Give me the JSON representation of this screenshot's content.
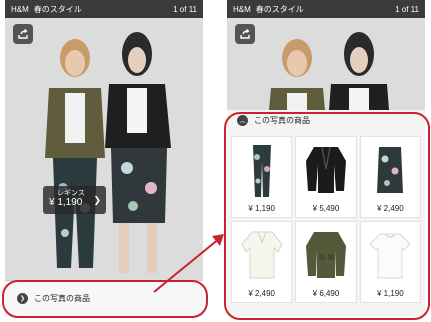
{
  "app": {
    "brand": "H&M",
    "title": "春のスタイル",
    "counter": "1 of 11"
  },
  "left_screen": {
    "icons": {
      "share": "share-icon"
    },
    "price_tag": {
      "category": "レギンス",
      "price": "¥ 1,190",
      "arrow": "chevron-right-icon"
    },
    "bottom_bar": {
      "label": "この写真の商品",
      "icon": "chevron-right-icon"
    }
  },
  "right_screen": {
    "panel": {
      "header": "この写真の商品",
      "icon": "chevron-up-icon",
      "items": [
        {
          "name": "leggings",
          "price": "¥ 1,190"
        },
        {
          "name": "leather-jacket",
          "price": "¥ 5,490"
        },
        {
          "name": "skirt",
          "price": "¥ 2,490"
        },
        {
          "name": "blouse",
          "price": "¥ 2,490"
        },
        {
          "name": "utility-jacket",
          "price": "¥ 6,490"
        },
        {
          "name": "tee",
          "price": "¥ 1,190"
        }
      ]
    }
  },
  "colors": {
    "highlight": "#c8242e",
    "topbar": "#3b3b3b"
  }
}
